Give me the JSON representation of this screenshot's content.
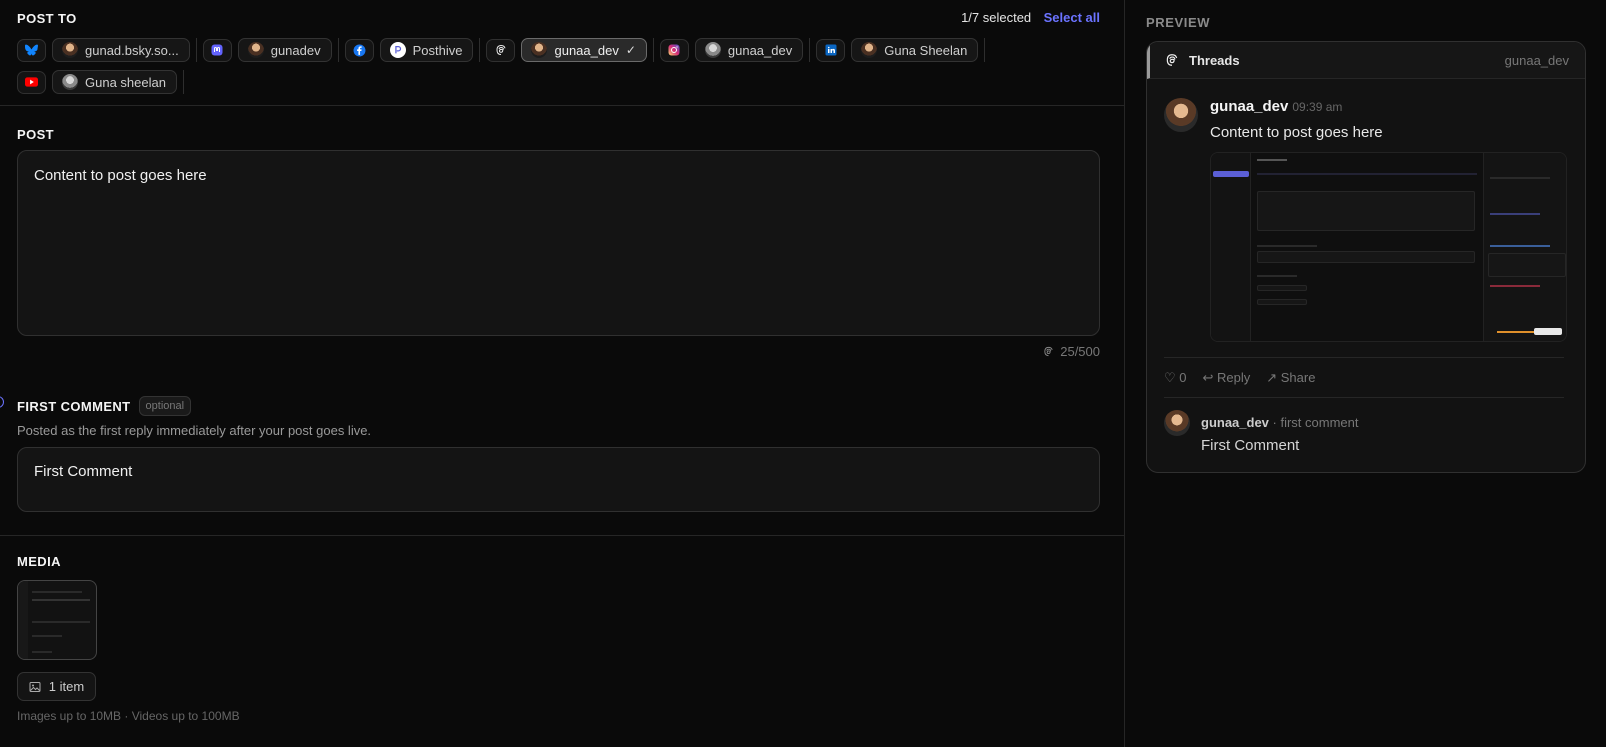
{
  "post_to": {
    "label": "POST TO",
    "selected_count": "1/7 selected",
    "select_all": "Select all",
    "accounts": [
      {
        "platform": "bluesky",
        "icon": "bluesky-icon",
        "name": "gunad.bsky.so...",
        "color": "#1185fe",
        "selected": false
      },
      {
        "platform": "mastodon",
        "icon": "mastodon-icon",
        "name": "gunadev",
        "color": "#6364ff",
        "selected": false
      },
      {
        "platform": "facebook",
        "icon": "facebook-icon",
        "name": "Posthive",
        "color": "#1877f2",
        "selected": false
      },
      {
        "platform": "threads",
        "icon": "threads-icon",
        "name": "gunaa_dev",
        "color": "#ffffff",
        "selected": true
      },
      {
        "platform": "instagram",
        "icon": "instagram-icon",
        "name": "gunaa_dev",
        "color": "#e1306c",
        "selected": false
      },
      {
        "platform": "linkedin",
        "icon": "linkedin-icon",
        "name": "Guna Sheelan",
        "color": "#0a66c2",
        "selected": false
      },
      {
        "platform": "youtube",
        "icon": "youtube-icon",
        "name": "Guna sheelan",
        "color": "#ff0000",
        "selected": false
      }
    ]
  },
  "post": {
    "label": "POST",
    "content": "Content to post goes here",
    "counter": "25/500"
  },
  "first_comment": {
    "label": "FIRST COMMENT",
    "optional": "optional",
    "description": "Posted as the first reply immediately after your post goes live.",
    "content": "First Comment"
  },
  "media": {
    "label": "MEDIA",
    "items_label": "1 item",
    "note": "Images up to 10MB · Videos up to 100MB"
  },
  "preview": {
    "label": "PREVIEW",
    "platform": "Threads",
    "handle": "gunaa_dev",
    "user": "gunaa_dev",
    "time": "09:39 am",
    "content": "Content to post goes here",
    "likes": "♡ 0",
    "reply": "↩ Reply",
    "share": "↗ Share",
    "comment_user": "gunaa_dev",
    "comment_meta": " · first comment",
    "comment_text": "First Comment"
  },
  "colors": {
    "accent": "#6b73ff",
    "background": "#0a0a0a"
  }
}
